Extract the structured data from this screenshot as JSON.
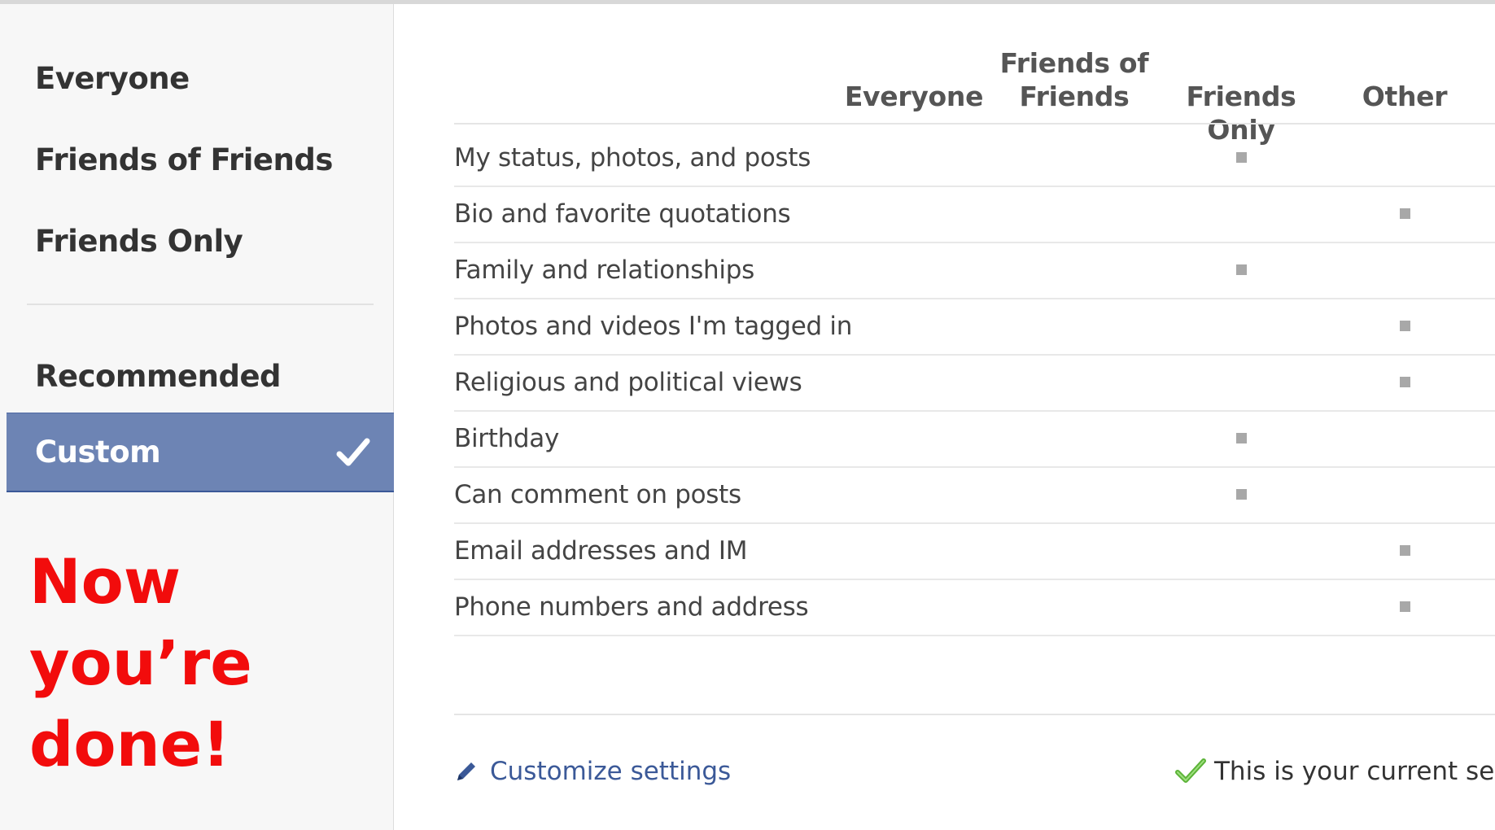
{
  "sidebar": {
    "items": [
      {
        "label": "Everyone"
      },
      {
        "label": "Friends of Friends"
      },
      {
        "label": "Friends Only"
      },
      {
        "label": "Recommended"
      },
      {
        "label": "Custom"
      }
    ],
    "selected_index": 4,
    "note_lines": [
      "Now",
      "you’re",
      "done!"
    ],
    "note_color": "#f20c0c",
    "selected_color": "#6d84b4"
  },
  "table": {
    "columns": [
      {
        "lines": [
          "Everyone"
        ]
      },
      {
        "lines": [
          "Friends of",
          "Friends"
        ]
      },
      {
        "lines": [
          "Friends Only"
        ]
      },
      {
        "lines": [
          "Other"
        ]
      }
    ],
    "rows": [
      {
        "label": "My status, photos, and posts",
        "selected_column": "Friends Only"
      },
      {
        "label": "Bio and favorite quotations",
        "selected_column": "Other"
      },
      {
        "label": "Family and relationships",
        "selected_column": "Friends Only"
      },
      {
        "label": "Photos and videos I'm tagged in",
        "selected_column": "Other"
      },
      {
        "label": "Religious and political views",
        "selected_column": "Other"
      },
      {
        "label": "Birthday",
        "selected_column": "Friends Only"
      },
      {
        "label": "Can comment on posts",
        "selected_column": "Friends Only"
      },
      {
        "label": "Email addresses and IM",
        "selected_column": "Other"
      },
      {
        "label": "Phone numbers and address",
        "selected_column": "Other"
      }
    ]
  },
  "footer": {
    "customize_label": "Customize settings",
    "current_setting_label": "This is your current setting."
  },
  "icons": {
    "selected": "check-icon",
    "customize": "pencil-icon",
    "current": "green-check-icon"
  },
  "colors": {
    "link": "#3b5998",
    "check_green": "#5cb338"
  }
}
